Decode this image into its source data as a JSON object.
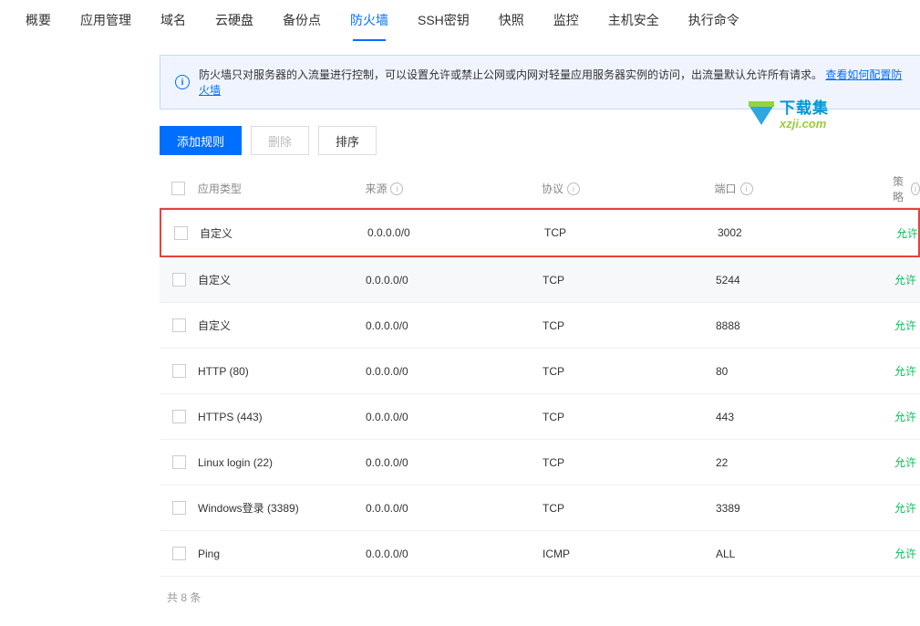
{
  "tabs": [
    "概要",
    "应用管理",
    "域名",
    "云硬盘",
    "备份点",
    "防火墙",
    "SSH密钥",
    "快照",
    "监控",
    "主机安全",
    "执行命令"
  ],
  "active_tab_index": 5,
  "banner": {
    "text": "防火墙只对服务器的入流量进行控制，可以设置允许或禁止公网或内网对轻量应用服务器实例的访问，出流量默认允许所有请求。",
    "link": "查看如何配置防火墙"
  },
  "buttons": {
    "add": "添加规则",
    "delete": "删除",
    "sort": "排序"
  },
  "headers": {
    "type": "应用类型",
    "source": "来源",
    "protocol": "协议",
    "port": "端口",
    "policy": "策略"
  },
  "rows": [
    {
      "type": "自定义",
      "source": "0.0.0.0/0",
      "protocol": "TCP",
      "port": "3002",
      "policy": "允许",
      "highlighted": true
    },
    {
      "type": "自定义",
      "source": "0.0.0.0/0",
      "protocol": "TCP",
      "port": "5244",
      "policy": "允许",
      "alt": true
    },
    {
      "type": "自定义",
      "source": "0.0.0.0/0",
      "protocol": "TCP",
      "port": "8888",
      "policy": "允许"
    },
    {
      "type": "HTTP (80)",
      "source": "0.0.0.0/0",
      "protocol": "TCP",
      "port": "80",
      "policy": "允许"
    },
    {
      "type": "HTTPS (443)",
      "source": "0.0.0.0/0",
      "protocol": "TCP",
      "port": "443",
      "policy": "允许"
    },
    {
      "type": "Linux login (22)",
      "source": "0.0.0.0/0",
      "protocol": "TCP",
      "port": "22",
      "policy": "允许"
    },
    {
      "type": "Windows登录 (3389)",
      "source": "0.0.0.0/0",
      "protocol": "TCP",
      "port": "3389",
      "policy": "允许"
    },
    {
      "type": "Ping",
      "source": "0.0.0.0/0",
      "protocol": "ICMP",
      "port": "ALL",
      "policy": "允许"
    }
  ],
  "footer": "共 8 条",
  "watermark": {
    "top": "下载集",
    "bottom": "xzji.com"
  }
}
